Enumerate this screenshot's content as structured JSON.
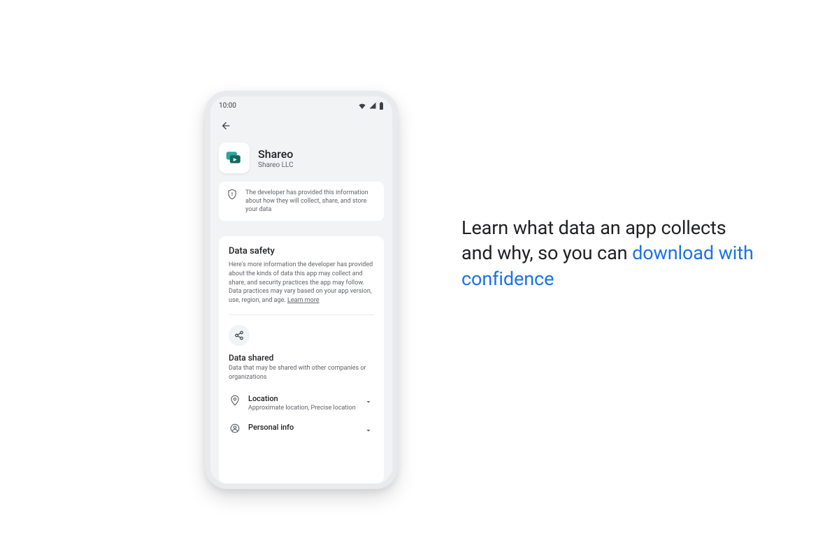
{
  "status": {
    "time": "10:00"
  },
  "app": {
    "name": "Shareo",
    "developer": "Shareo LLC"
  },
  "banner": {
    "text": "The developer has provided this information about how they will collect, share, and store your data"
  },
  "safety": {
    "title": "Data safety",
    "desc": "Here's more information the developer has provided about the kinds of data this app may collect and share, and security practices the app may follow. Data practices may vary based on your app version, use, region, and age. ",
    "learn_more": "Learn more"
  },
  "shared": {
    "title": "Data shared",
    "subtitle": "Data that may be shared with other companies or organizations",
    "rows": [
      {
        "title": "Location",
        "subtitle": "Approximate location, Precise location"
      },
      {
        "title": "Personal info",
        "subtitle": ""
      }
    ]
  },
  "headline": {
    "line1": "Learn what data an app collects and why, so you can ",
    "accent": "download with confidence"
  },
  "colors": {
    "accent": "#1a73e8"
  }
}
